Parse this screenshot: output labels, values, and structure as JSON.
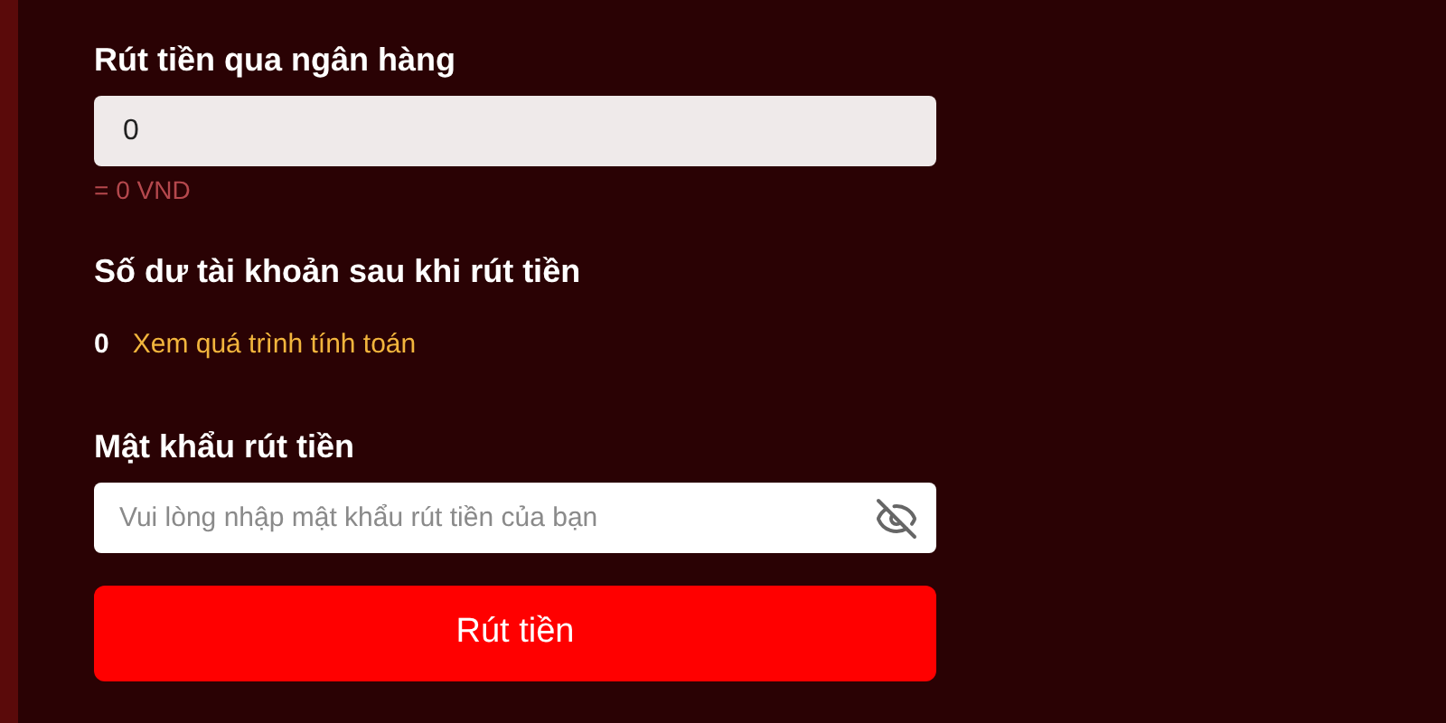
{
  "amount": {
    "label": "Rút tiền qua ngân hàng",
    "value": "0",
    "converted": "= 0 VND"
  },
  "balance": {
    "heading": "Số dư tài khoản sau khi rút tiền",
    "value": "0",
    "link": "Xem quá trình tính toán"
  },
  "password": {
    "label": "Mật khẩu rút tiền",
    "placeholder": "Vui lòng nhập mật khẩu rút tiền của bạn",
    "visible": false
  },
  "submit": {
    "label": "Rút tiền"
  }
}
